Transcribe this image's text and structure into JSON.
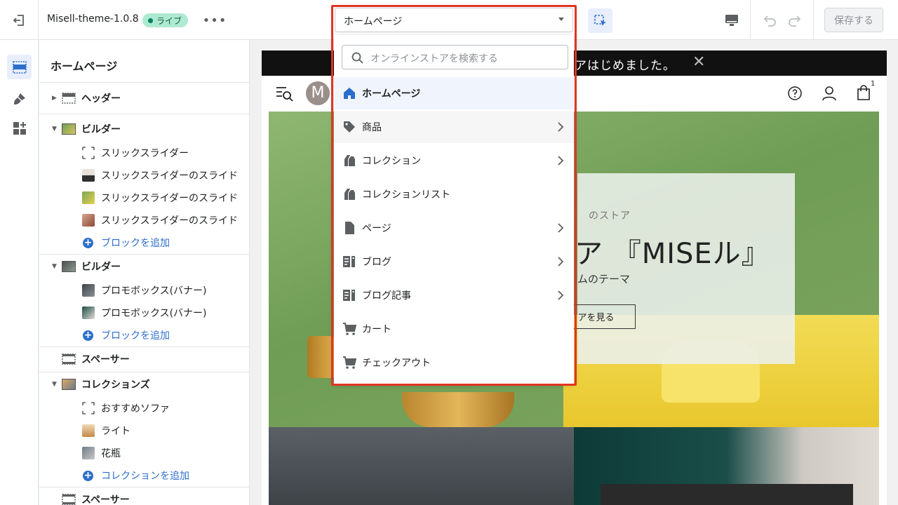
{
  "topbar": {
    "theme_name": "Misell-theme-1.0.8",
    "live_badge": "ライブ",
    "more_label": "•••",
    "save_label": "保存する"
  },
  "page_select": {
    "value": "ホームページ",
    "search_placeholder": "オンラインストアを検索する",
    "items": [
      {
        "label": "ホームページ",
        "icon": "home-icon",
        "has_submenu": false,
        "state": "selected"
      },
      {
        "label": "商品",
        "icon": "tag-icon",
        "has_submenu": true,
        "state": "hover"
      },
      {
        "label": "コレクション",
        "icon": "collection-icon",
        "has_submenu": true,
        "state": ""
      },
      {
        "label": "コレクションリスト",
        "icon": "collection-list-icon",
        "has_submenu": false,
        "state": ""
      },
      {
        "label": "ページ",
        "icon": "page-icon",
        "has_submenu": true,
        "state": ""
      },
      {
        "label": "ブログ",
        "icon": "blog-icon",
        "has_submenu": true,
        "state": ""
      },
      {
        "label": "ブログ記事",
        "icon": "blog-post-icon",
        "has_submenu": true,
        "state": ""
      },
      {
        "label": "カート",
        "icon": "cart-icon",
        "has_submenu": false,
        "state": ""
      },
      {
        "label": "チェックアウト",
        "icon": "checkout-icon",
        "has_submenu": false,
        "state": ""
      }
    ]
  },
  "sidebar": {
    "title": "ホームページ",
    "header_label": "ヘッダー",
    "sections": [
      {
        "label": "ビルダー",
        "blocks": [
          "スリックスライダー",
          "スリックスライダーのスライド",
          "スリックスライダーのスライド",
          "スリックスライダーのスライド"
        ],
        "add_label": "ブロックを追加"
      },
      {
        "label": "ビルダー",
        "blocks": [
          "プロモボックス(バナー)",
          "プロモボックス(バナー)"
        ],
        "add_label": "ブロックを追加"
      },
      {
        "label": "スペーサー"
      },
      {
        "label": "コレクションズ",
        "blocks": [
          "おすすめソファ",
          "ライト",
          "花瓶"
        ],
        "add_label": "コレクションを追加"
      },
      {
        "label": "スペーサー"
      }
    ]
  },
  "preview": {
    "announcement": "アはじめました。",
    "close_glyph": "✕",
    "cart_count": "1",
    "hero_eyebrow": "のストア",
    "hero_title": "ア 『MISEル』",
    "hero_sub": "ムのテーマ",
    "hero_cta": "アを見る",
    "avatar_letter": "M"
  },
  "colors": {
    "accent": "#2c6ecb",
    "frame": "#e03524",
    "live_badge_bg": "#aee9d1"
  }
}
